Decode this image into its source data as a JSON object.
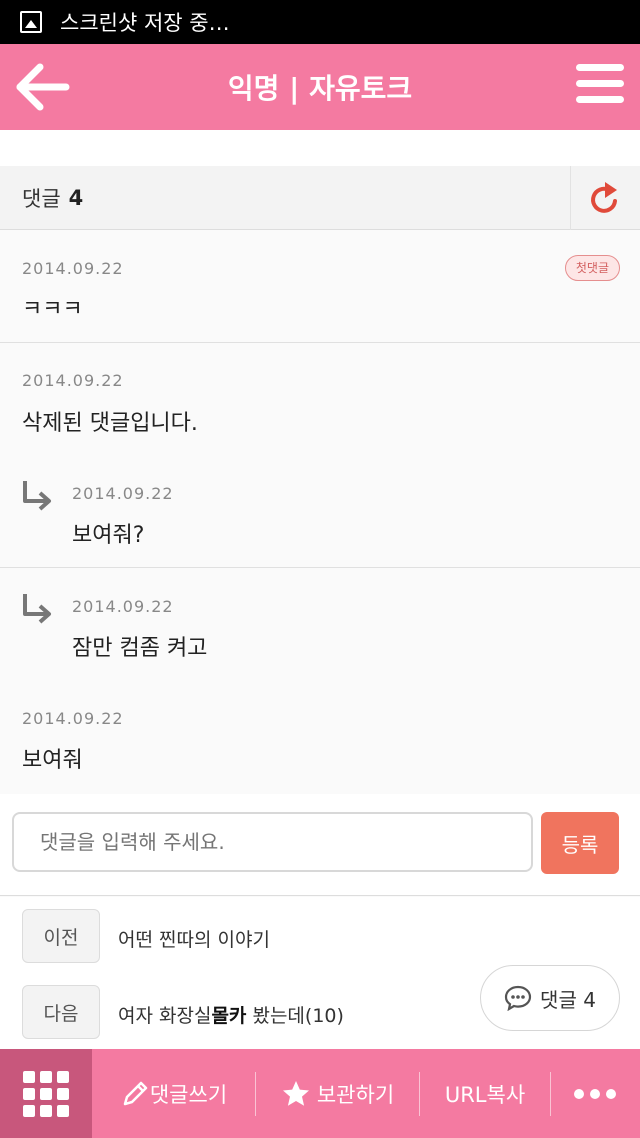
{
  "status_bar": {
    "text": "스크린샷 저장 중…"
  },
  "app_bar": {
    "title": "익명 | 자유토크"
  },
  "comments_header": {
    "label": "댓글",
    "count": "4"
  },
  "comments": [
    {
      "date": "2014.09.22",
      "text": "ㅋㅋㅋ",
      "badge": "첫댓글"
    },
    {
      "date": "2014.09.22",
      "text": "삭제된 댓글입니다."
    },
    {
      "date": "2014.09.22",
      "text": "보여줘?"
    },
    {
      "date": "2014.09.22",
      "text": "잠만 컴좀 켜고"
    },
    {
      "date": "2014.09.22",
      "text": "보여줘"
    }
  ],
  "comment_input": {
    "placeholder": "댓글을 입력해 주세요.",
    "submit_label": "등록"
  },
  "navigation": {
    "prev_label": "이전",
    "prev_title": "어떤 찐따의 이야기",
    "next_label": "다음",
    "next_title_pre": "여자 화장실",
    "next_title_bold": "몰카",
    "next_title_post": " 봤는데(10)"
  },
  "floating_button": {
    "label": "댓글 4"
  },
  "bottom_bar": {
    "write": "댓글쓰기",
    "save": "보관하기",
    "url": "URL복사"
  },
  "colors": {
    "accent": "#f47aa1",
    "accent_dark": "#c8577c",
    "submit": "#f0745e",
    "refresh": "#e04a3a"
  }
}
